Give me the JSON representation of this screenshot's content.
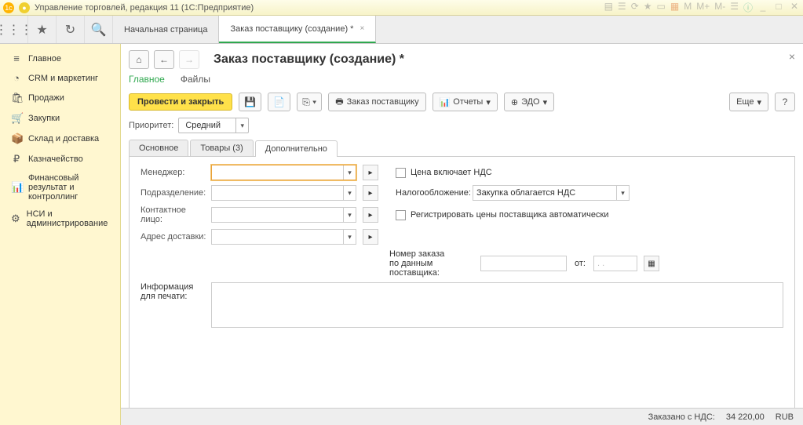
{
  "titlebar": {
    "text": "Управление торговлей, редакция 11  (1С:Предприятие)"
  },
  "apptabs": [
    {
      "label": "Начальная страница"
    },
    {
      "label": "Заказ поставщику (создание) *"
    }
  ],
  "sidebar": [
    {
      "icon": "⌂",
      "label": "Главное"
    },
    {
      "icon": "◔",
      "label": "CRM и маркетинг"
    },
    {
      "icon": "🛍",
      "label": "Продажи"
    },
    {
      "icon": "🛒",
      "label": "Закупки"
    },
    {
      "icon": "📦",
      "label": "Склад и доставка"
    },
    {
      "icon": "₽",
      "label": "Казначейство"
    },
    {
      "icon": "📊",
      "label": "Финансовый результат и контроллинг"
    },
    {
      "icon": "⚙",
      "label": "НСИ и администрирование"
    }
  ],
  "doc": {
    "title": "Заказ поставщику (создание) *",
    "subtabs": [
      "Главное",
      "Файлы"
    ],
    "actions": {
      "post_close": "Провести и закрыть",
      "order_btn": "Заказ поставщику",
      "reports": "Отчеты",
      "edo": "ЭДО",
      "more": "Еще"
    },
    "priority_label": "Приоритет:",
    "priority_value": "Средний",
    "inner_tabs": [
      "Основное",
      "Товары (3)",
      "Дополнительно"
    ],
    "fields": {
      "manager": "Менеджер:",
      "department": "Подразделение:",
      "contact": "Контактное лицо:",
      "addr": "Адрес доставки:",
      "vat_incl": "Цена включает НДС",
      "taxation": "Налогообложение:",
      "taxation_val": "Закупка облагается НДС",
      "register_prices": "Регистрировать цены поставщика автоматически",
      "order_no": "Номер заказа",
      "order_no2": "по данным поставщика:",
      "from": "от:",
      "date_placeholder": ".   .",
      "print_info": "Информация",
      "print_info2": "для печати:"
    }
  },
  "footer": {
    "label": "Заказано с НДС:",
    "amount": "34 220,00",
    "currency": "RUB"
  }
}
